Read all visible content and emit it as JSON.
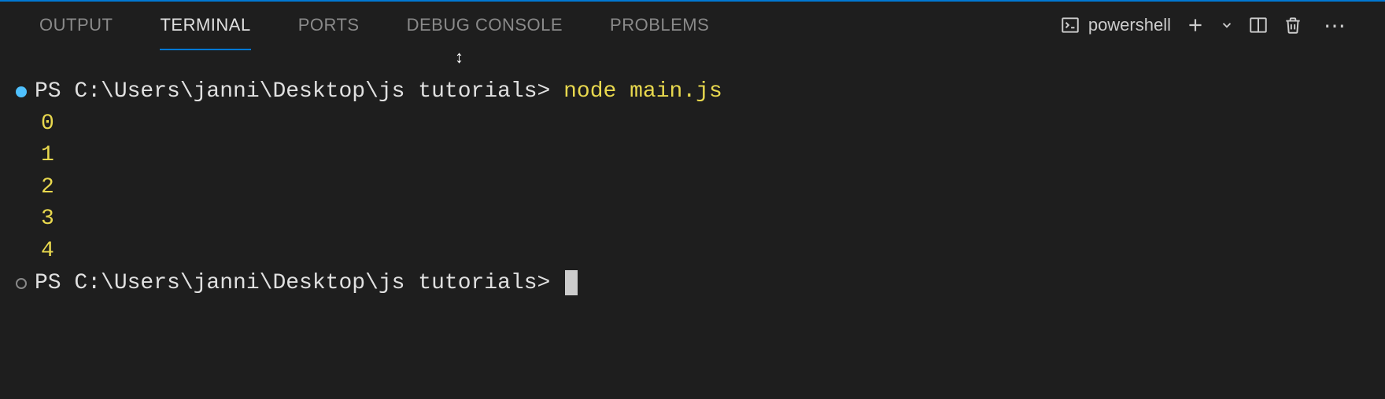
{
  "tabs": {
    "output": "OUTPUT",
    "terminal": "TERMINAL",
    "ports": "PORTS",
    "debug_console": "DEBUG CONSOLE",
    "problems": "PROBLEMS"
  },
  "shell": {
    "name": "powershell"
  },
  "terminal": {
    "line1": {
      "prompt": "PS C:\\Users\\janni\\Desktop\\js tutorials> ",
      "command": "node main.js"
    },
    "output": [
      "0",
      "1",
      "2",
      "3",
      "4"
    ],
    "line2": {
      "prompt": "PS C:\\Users\\janni\\Desktop\\js tutorials> "
    }
  }
}
